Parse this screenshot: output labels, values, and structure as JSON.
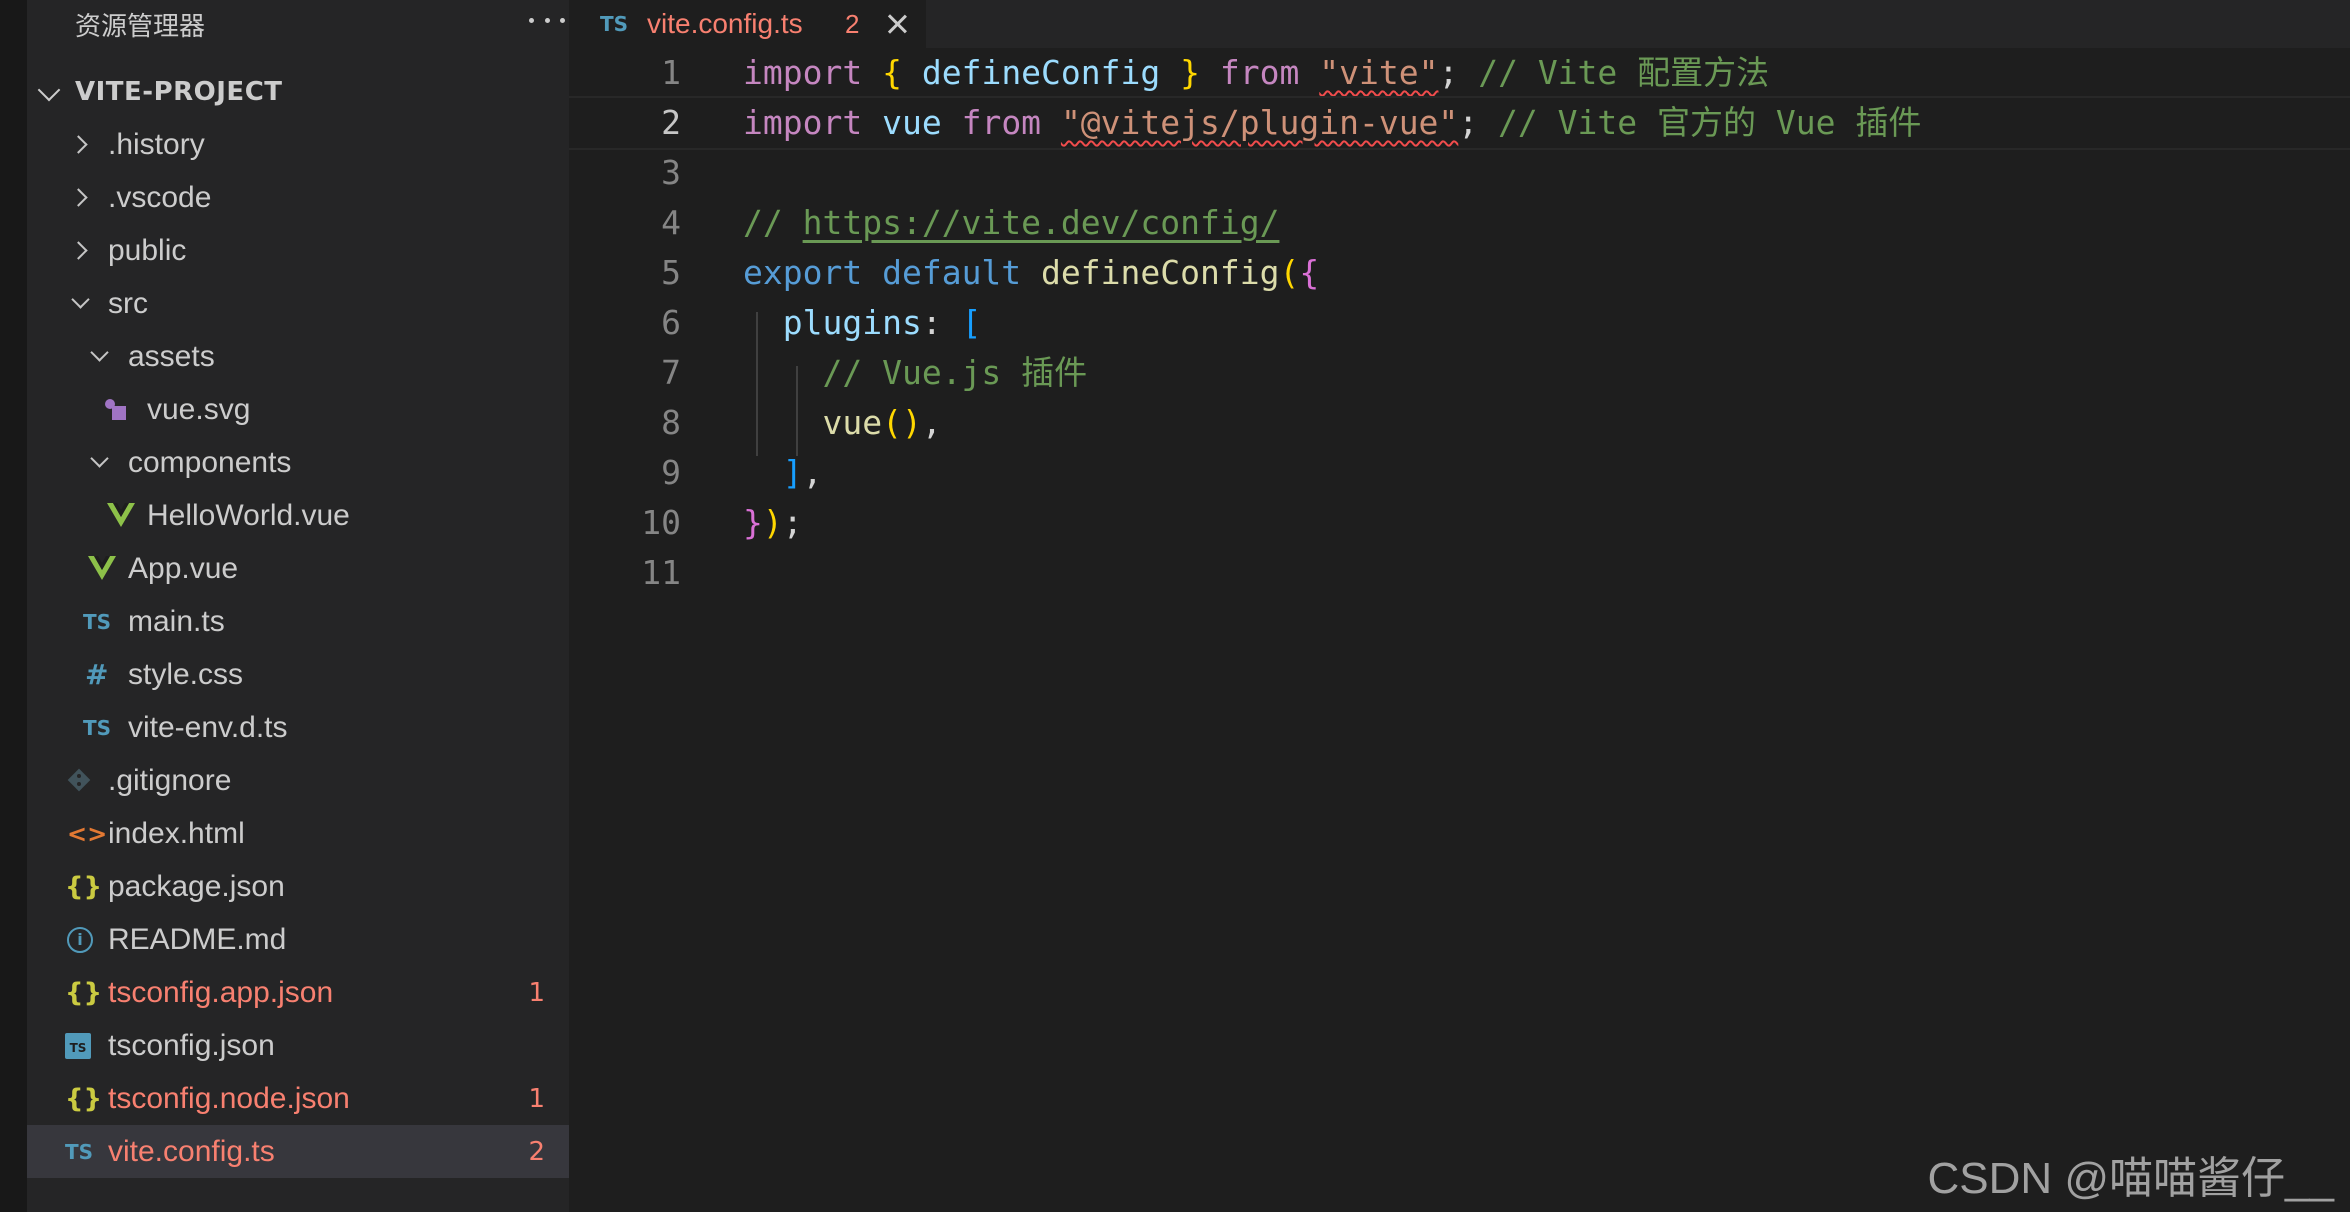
{
  "sidebar": {
    "title": "资源管理器",
    "project": "VITE-PROJECT",
    "items": [
      {
        "label": ".history"
      },
      {
        "label": ".vscode"
      },
      {
        "label": "public"
      },
      {
        "label": "src"
      },
      {
        "label": "assets"
      },
      {
        "label": "vue.svg"
      },
      {
        "label": "components"
      },
      {
        "label": "HelloWorld.vue"
      },
      {
        "label": "App.vue"
      },
      {
        "label": "main.ts",
        "icon": "TS"
      },
      {
        "label": "style.css",
        "icon": "#"
      },
      {
        "label": "vite-env.d.ts",
        "icon": "TS"
      },
      {
        "label": ".gitignore"
      },
      {
        "label": "index.html",
        "icon": "<>"
      },
      {
        "label": "package.json",
        "icon": "{}"
      },
      {
        "label": "README.md",
        "icon": "i"
      },
      {
        "label": "tsconfig.app.json",
        "icon": "{}",
        "badge": "1"
      },
      {
        "label": "tsconfig.json",
        "icon": "TS"
      },
      {
        "label": "tsconfig.node.json",
        "icon": "{}",
        "badge": "1"
      },
      {
        "label": "vite.config.ts",
        "icon": "TS",
        "badge": "2"
      }
    ]
  },
  "tab": {
    "lang": "TS",
    "name": "vite.config.ts",
    "problems": "2"
  },
  "editor": {
    "line_numbers": [
      "1",
      "2",
      "3",
      "4",
      "5",
      "6",
      "7",
      "8",
      "9",
      "10",
      "11"
    ],
    "active_line": "2",
    "tokens": {
      "l1": [
        "import",
        "{",
        "defineConfig",
        "}",
        "from",
        "\"vite\"",
        ";",
        "// Vite 配置方法"
      ],
      "l2": [
        "import",
        "vue",
        "from",
        "\"@vitejs/plugin-vue\"",
        ";",
        "// Vite 官方的 Vue 插件"
      ],
      "l4": [
        "// ",
        "https://vite.dev/config/"
      ],
      "l5": [
        "export",
        "default",
        "defineConfig",
        "(",
        "{"
      ],
      "l6": [
        "plugins",
        ":",
        "["
      ],
      "l7": [
        "// Vue.js 插件"
      ],
      "l8": [
        "vue",
        "()",
        ","
      ],
      "l9": [
        "]",
        ","
      ],
      "l10": [
        "}",
        ")",
        ";"
      ]
    }
  },
  "watermark": "CSDN @喵喵酱仔__",
  "colors": {
    "error": "#f88070",
    "ts_icon": "#519aba",
    "vue_icon": "#8dc149",
    "selected_row": "#37373d"
  }
}
